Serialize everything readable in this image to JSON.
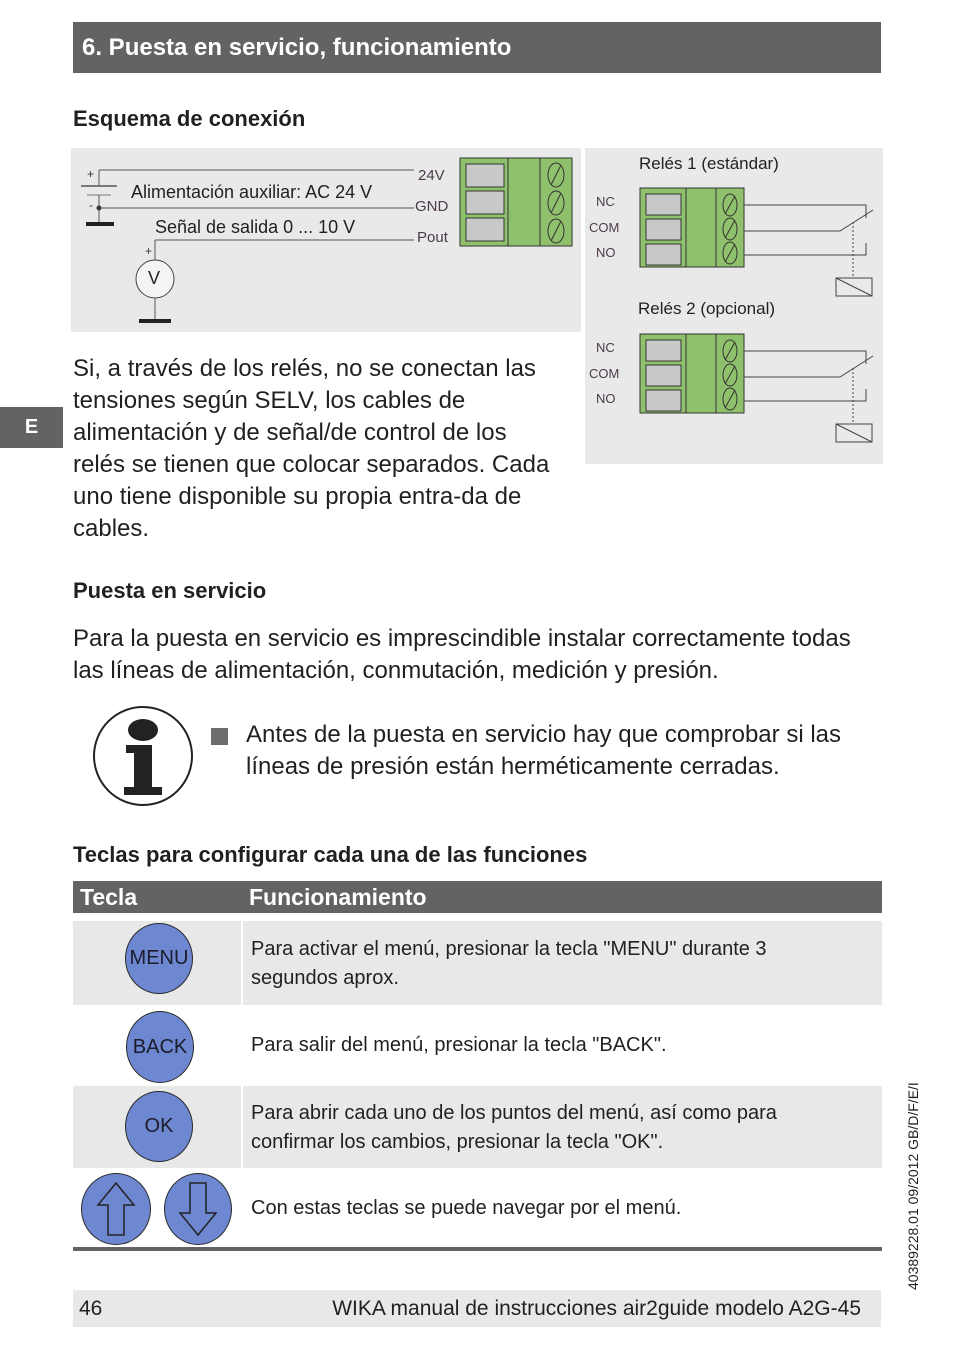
{
  "header": {
    "title": "6. Puesta en servicio, funcionamiento"
  },
  "side_tab": {
    "label": "E"
  },
  "connection": {
    "heading": "Esquema de conexión",
    "power_label": "Alimentación auxiliar: AC 24 V",
    "signal_label": "Señal de salida 0 ... 10 V",
    "voltmeter_symbol": "V",
    "plus_sign": "+",
    "minus_sign": "-",
    "terminals": [
      "24V",
      "GND",
      "Pout"
    ],
    "relay1_title": "Relés 1 (estándar)",
    "relay2_title": "Relés 2 (opcional)",
    "relay_terminals": [
      "NC",
      "COM",
      "NO"
    ]
  },
  "selv_paragraph": "Si, a través de los relés, no se conectan las tensiones según SELV, los cables de alimentación y de señal/de control de los relés se tienen que colocar separados. Cada uno tiene disponible su propia entra-da de cables.",
  "commissioning": {
    "heading": "Puesta en servicio",
    "paragraph": "Para la puesta en servicio es imprescindible instalar correctamente todas las líneas de alimentación, conmutación, medición y presión.",
    "note_icon": "info-icon",
    "note": "Antes de la puesta en servicio hay que comprobar si las líneas de presión están herméticamente cerradas."
  },
  "keys_section": {
    "heading": "Teclas para configurar cada una de las funciones",
    "columns": [
      "Tecla",
      "Funcionamiento"
    ],
    "rows": [
      {
        "key": "MENU",
        "description": "Para activar el menú, presionar la tecla \"MENU\" durante 3 segundos aprox."
      },
      {
        "key": "BACK",
        "description": "Para salir del menú, presionar la tecla \"BACK\"."
      },
      {
        "key": "OK",
        "description": "Para abrir cada uno de los puntos del menú, así como para confirmar los cambios, presionar la tecla \"OK\"."
      },
      {
        "key_icons": [
          "arrow-up-icon",
          "arrow-down-icon"
        ],
        "description": "Con estas teclas se puede navegar por el menú."
      }
    ]
  },
  "colors": {
    "header_grey": "#646263",
    "key_blue": "#6d87d1",
    "terminal_green": "#8fc06c",
    "panel_grey": "#e9e9e9"
  },
  "footer": {
    "page_number": "46",
    "text": "WIKA manual de instrucciones air2guide modelo A2G-45"
  },
  "doc_id": "40389228.01 09/2012 GB/D/F/E/I"
}
